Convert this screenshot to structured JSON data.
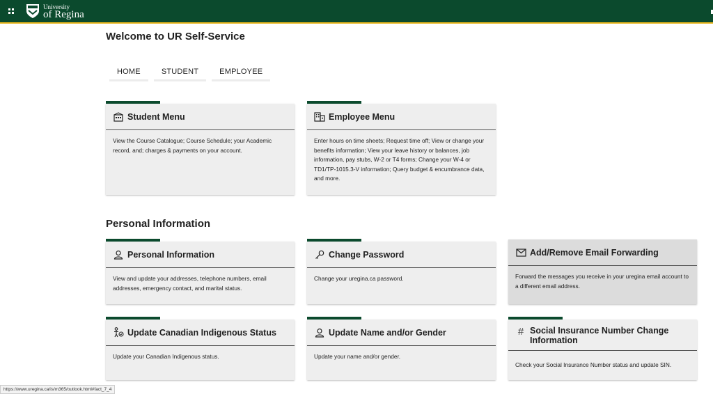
{
  "header": {
    "logo_line1": "University",
    "logo_line2": "of Regina"
  },
  "page_title": "Welcome to UR Self-Service",
  "nav": {
    "tabs": [
      {
        "label": "HOME"
      },
      {
        "label": "STUDENT"
      },
      {
        "label": "EMPLOYEE"
      }
    ]
  },
  "menus": [
    {
      "title": "Student Menu",
      "icon": "building-icon",
      "description": "View the Course Catalogue; Course Schedule; your Academic record, and; charges & payments on your account."
    },
    {
      "title": "Employee Menu",
      "icon": "office-icon",
      "description": "Enter hours on time sheets; Request time off; View or change your benefits information; View your leave history or balances, job information, pay stubs, W-2 or T4 forms; Change your W-4 or TD1/TP-1015.3-V information; Query budget & encumbrance data, and more."
    }
  ],
  "personal_section_title": "Personal Information",
  "personal_cards": [
    {
      "title": "Personal Information",
      "icon": "person-icon",
      "description": "View and update your addresses, telephone numbers, email addresses, emergency contact, and marital status."
    },
    {
      "title": "Change Password",
      "icon": "key-icon",
      "description": "Change your uregina.ca password."
    },
    {
      "title": "Add/Remove Email Forwarding",
      "icon": "envelope-icon",
      "description": "Forward the messages you receive in your uregina email account to a different email address."
    },
    {
      "title": "Update Canadian Indigenous Status",
      "icon": "person-badge-icon",
      "description": "Update your Canadian Indigenous status."
    },
    {
      "title": "Update Name and/or Gender",
      "icon": "person-icon",
      "description": "Update your name and/or gender."
    },
    {
      "title": "Social Insurance Number Change Information",
      "icon": "hash-icon",
      "description": "Check your Social Insurance Number status and update SIN."
    }
  ],
  "status_url": "https://www.uregina.ca/is/m365/outlook.html#fact_7_4",
  "colors": {
    "brand_green": "#0b4a2d",
    "brand_gold": "#e7b51a",
    "card_bg": "#eeeeee",
    "card_hover_bg": "#dcdcdc"
  }
}
